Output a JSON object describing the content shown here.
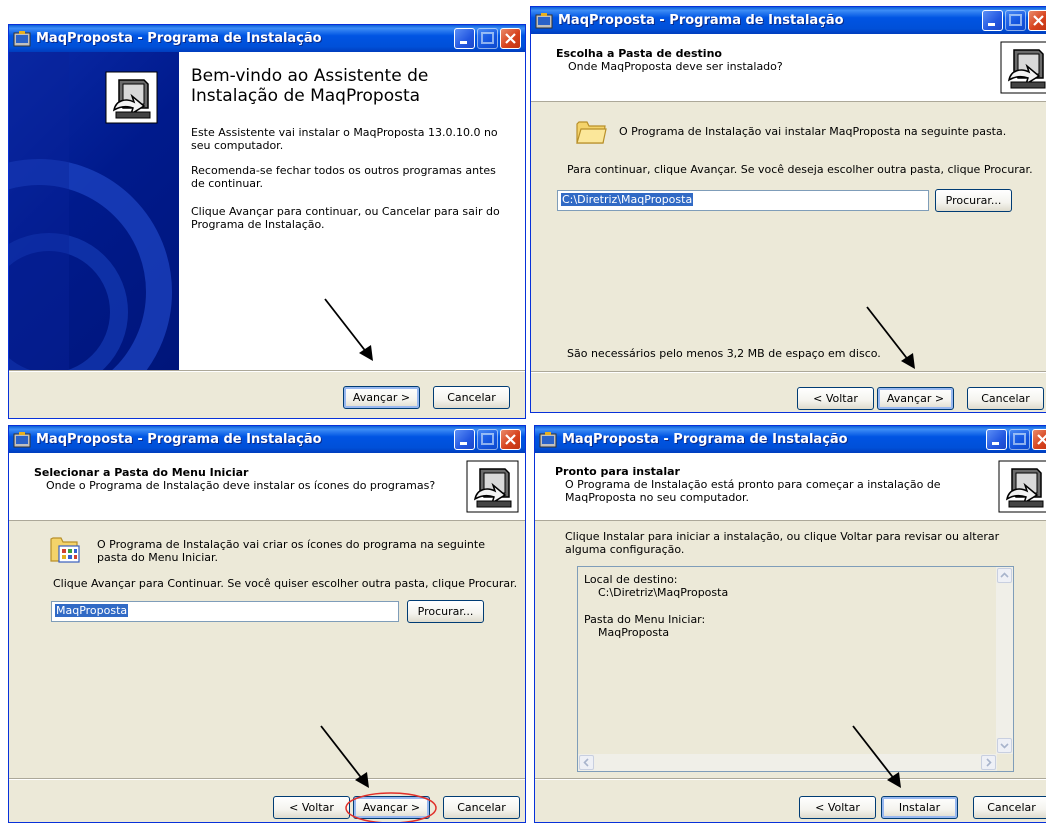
{
  "window_title": "MaqProposta - Programa de Instalação",
  "buttons": {
    "back": "< Voltar",
    "next": "Avançar >",
    "cancel": "Cancelar",
    "browse": "Procurar...",
    "install": "Instalar"
  },
  "welcome": {
    "heading": "Bem-vindo ao Assistente de Instalação de MaqProposta",
    "para1": "Este Assistente vai instalar o MaqProposta 13.0.10.0 no seu computador.",
    "para2": "Recomenda-se fechar todos os outros programas antes de continuar.",
    "para3": "Clique Avançar para continuar, ou Cancelar para sair do Programa de Instalação."
  },
  "destination": {
    "title": "Escolha a Pasta de destino",
    "subtitle": "Onde MaqProposta deve ser instalado?",
    "info": "O Programa de Instalação vai instalar MaqProposta na seguinte pasta.",
    "instruction": "Para continuar, clique Avançar. Se você deseja escolher outra pasta, clique Procurar.",
    "path_value": "C:\\Diretriz\\MaqProposta",
    "space_required": "São necessários pelo menos 3,2 MB de espaço em disco."
  },
  "start_menu": {
    "title": "Selecionar a Pasta do Menu Iniciar",
    "subtitle": "Onde o Programa de Instalação deve instalar os ícones do programas?",
    "info": "O Programa de Instalação vai criar os ícones do programa na seguinte pasta do Menu Iniciar.",
    "instruction": "Clique Avançar para Continuar. Se você quiser escolher outra pasta, clique Procurar.",
    "folder_value": "MaqProposta"
  },
  "ready": {
    "title": "Pronto para instalar",
    "subtitle": "O Programa de Instalação está pronto para começar a instalação de MaqProposta no seu computador.",
    "instruction": "Clique Instalar para iniciar a instalação, ou clique Voltar para revisar ou alterar alguma configuração.",
    "memo_dest_label": "Local de destino:",
    "memo_dest_value": "C:\\Diretriz\\MaqProposta",
    "memo_menu_label": "Pasta do Menu Iniciar:",
    "memo_menu_value": "MaqProposta"
  },
  "colors": {
    "titlebar": "#0054e3",
    "dialog_bg": "#ece9d8",
    "welcome_panel": "#001c8a",
    "selection": "#316ac5",
    "highlight_ellipse": "#e0302a"
  }
}
